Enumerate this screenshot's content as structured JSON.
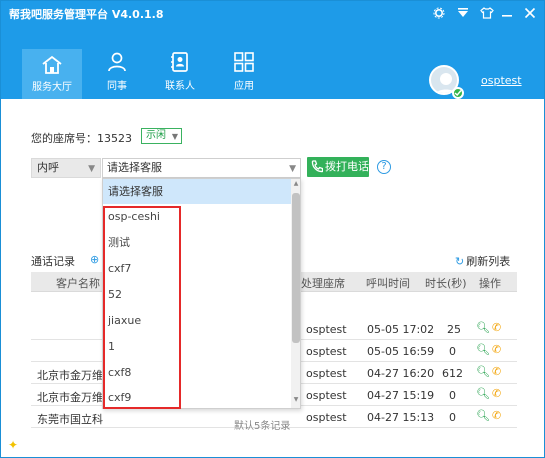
{
  "app": {
    "title": "帮我吧服务管理平台 V4.0.1.8",
    "username": "osptest"
  },
  "nav": {
    "items": [
      {
        "label": "服务大厅",
        "icon": "home-icon",
        "active": true
      },
      {
        "label": "同事",
        "icon": "colleague-icon",
        "active": false
      },
      {
        "label": "联系人",
        "icon": "contacts-icon",
        "active": false
      },
      {
        "label": "应用",
        "icon": "apps-icon",
        "active": false
      }
    ]
  },
  "seat": {
    "label": "您的座席号：13523",
    "status": "示闲"
  },
  "dial": {
    "direction": "内呼",
    "agent_placeholder": "请选择客服",
    "call_button": "拨打电话",
    "help": "?"
  },
  "dropdown": {
    "options": [
      "请选择客服",
      "osp-ceshi",
      "测试",
      "cxf7",
      "52",
      "jiaxue",
      "1",
      "cxf8",
      "cxf9"
    ],
    "selected_index": 0
  },
  "records": {
    "label": "通话记录",
    "refresh": "刷新列表",
    "columns": [
      "客户名称",
      "处理座席",
      "呼叫时间",
      "时长(秒)",
      "操作"
    ],
    "rows": [
      {
        "customer": "",
        "agent": "osptest",
        "time": "05-05 17:02",
        "duration": "25"
      },
      {
        "customer": "",
        "agent": "osptest",
        "time": "05-05 16:59",
        "duration": "0"
      },
      {
        "customer": "北京市金万维",
        "agent": "osptest",
        "time": "04-27 16:20",
        "duration": "612"
      },
      {
        "customer": "北京市金万维",
        "agent": "osptest",
        "time": "04-27 15:19",
        "duration": "0"
      },
      {
        "customer": "东莞市国立科",
        "agent": "osptest",
        "time": "04-27 15:13",
        "duration": "0"
      }
    ],
    "footer": "默认5条记录"
  },
  "colors": {
    "titlebar": "#1e9be8",
    "nav_active": "#48b1ef",
    "call_button": "#33b15a",
    "highlight": "#e52929"
  }
}
